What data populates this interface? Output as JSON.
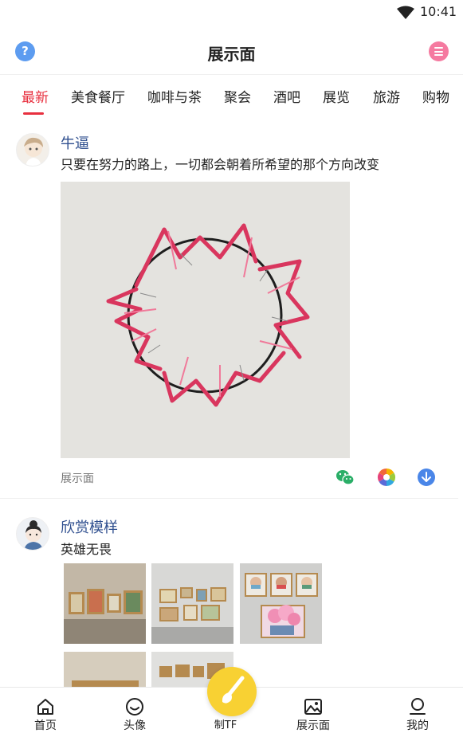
{
  "status_bar": {
    "time": "10:41",
    "wifi_icon": "wifi-icon"
  },
  "app_bar": {
    "title": "展示面",
    "help_icon": "question-icon",
    "help_glyph": "?",
    "menu_icon": "list-menu-icon"
  },
  "tabs": [
    {
      "label": "最新",
      "active": true
    },
    {
      "label": "美食餐厅",
      "active": false
    },
    {
      "label": "咖啡与茶",
      "active": false
    },
    {
      "label": "聚会",
      "active": false
    },
    {
      "label": "酒吧",
      "active": false
    },
    {
      "label": "展览",
      "active": false
    },
    {
      "label": "旅游",
      "active": false
    },
    {
      "label": "购物",
      "active": false
    }
  ],
  "feed": [
    {
      "username": "牛逼",
      "caption": "只要在努力的路上，一切都会朝着所希望的那个方向改变",
      "source": "展示面",
      "share_icons": [
        "wechat-icon",
        "moments-icon",
        "download-icon"
      ]
    },
    {
      "username": "欣赏模样",
      "caption": "英雄无畏"
    }
  ],
  "bottom_nav": [
    {
      "label": "首页",
      "icon": "home-icon",
      "active": false
    },
    {
      "label": "头像",
      "icon": "smile-icon",
      "active": false
    },
    {
      "label": "制TF",
      "icon": "brush-icon",
      "active": false
    },
    {
      "label": "展示面",
      "icon": "gallery-icon",
      "active": true
    },
    {
      "label": "我的",
      "icon": "profile-icon",
      "active": false
    }
  ],
  "colors": {
    "accent": "#e8303f",
    "username": "#2f4f8f",
    "fab": "#f8d133"
  }
}
